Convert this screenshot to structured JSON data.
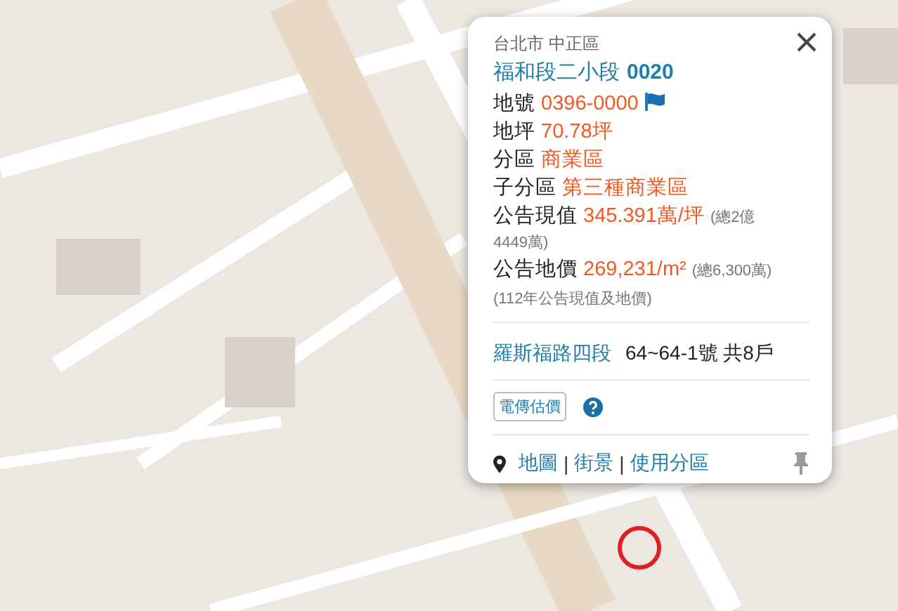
{
  "popup": {
    "district": "台北市 中正區",
    "parcel": {
      "name": "福和段二小段",
      "number": "0020"
    },
    "fields": [
      {
        "label": "地號",
        "value": "0396-0000",
        "flag": true
      },
      {
        "label": "地坪",
        "value": "70.78坪",
        "flag": false
      },
      {
        "label": "分區",
        "value": "商業區",
        "flag": false
      },
      {
        "label": "子分區",
        "value": "第三種商業區",
        "flag": false
      },
      {
        "label": "公告現值",
        "value": "345.391萬/坪",
        "note": "(總2億",
        "note_continued": "4449萬)",
        "flag": false
      },
      {
        "label": "公告地價",
        "value": "269,231/m²",
        "note": "(總6,300萬)",
        "flag": false
      }
    ],
    "footnote": "(112年公告現值及地價)",
    "address": {
      "road": "羅斯福路四段",
      "detail": "64~64-1號 共8戶"
    },
    "estimate_button": "電傳估價",
    "links": [
      "地圖",
      "街景",
      "使用分區"
    ],
    "separator": "|"
  }
}
